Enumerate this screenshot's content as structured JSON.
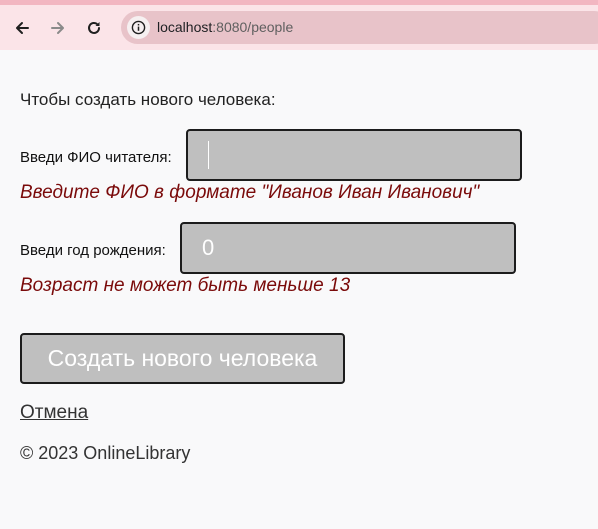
{
  "browser": {
    "url_host": "localhost",
    "url_rest": ":8080/people",
    "accent": "#f2b6c1",
    "toolbar_bg": "#fbe4e8"
  },
  "form": {
    "intro": "Чтобы создать нового человека:",
    "name_label": "Введи ФИО читателя:",
    "name_value": "",
    "name_error": "Введите ФИО в формате \"Иванов Иван Иванович\"",
    "year_label": "Введи год рождения:",
    "year_value": "0",
    "year_error": "Возраст не может быть меньше 13",
    "submit_label": "Создать нового человека",
    "cancel_label": "Отмена",
    "error_color": "#7a0a0a",
    "input_bg": "#bfbfbf"
  },
  "footer": {
    "text": "© 2023 OnlineLibrary"
  }
}
